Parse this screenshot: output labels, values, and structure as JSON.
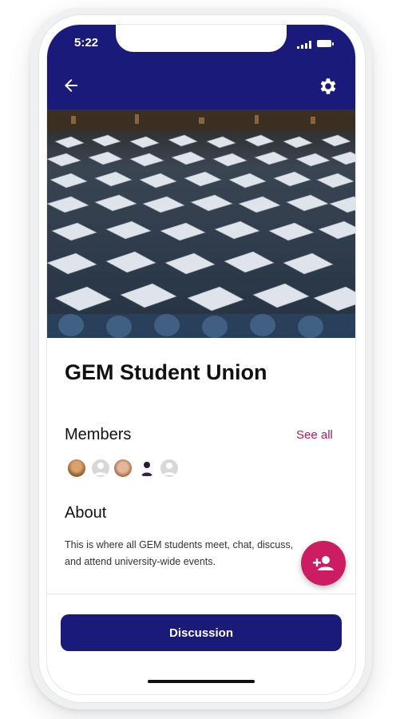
{
  "status_bar": {
    "time": "5:22"
  },
  "header": {
    "back_icon": "arrow-left-icon",
    "settings_icon": "gear-icon",
    "color": "#1a1a7a"
  },
  "hero": {
    "icon": "graduation-caps-photo"
  },
  "group": {
    "title": "GEM Student Union"
  },
  "members": {
    "label": "Members",
    "see_all": "See all",
    "avatars": [
      "avatar-1",
      "avatar-2",
      "avatar-3",
      "avatar-4",
      "avatar-5"
    ]
  },
  "about": {
    "label": "About",
    "text": "This is where all GEM students meet, chat, discuss, and attend university-wide events."
  },
  "fab": {
    "icon": "add-person-icon",
    "color": "#cc1d63"
  },
  "bottom": {
    "discussion_label": "Discussion"
  },
  "colors": {
    "accent": "#c2185b",
    "primary": "#1a1a7a"
  }
}
